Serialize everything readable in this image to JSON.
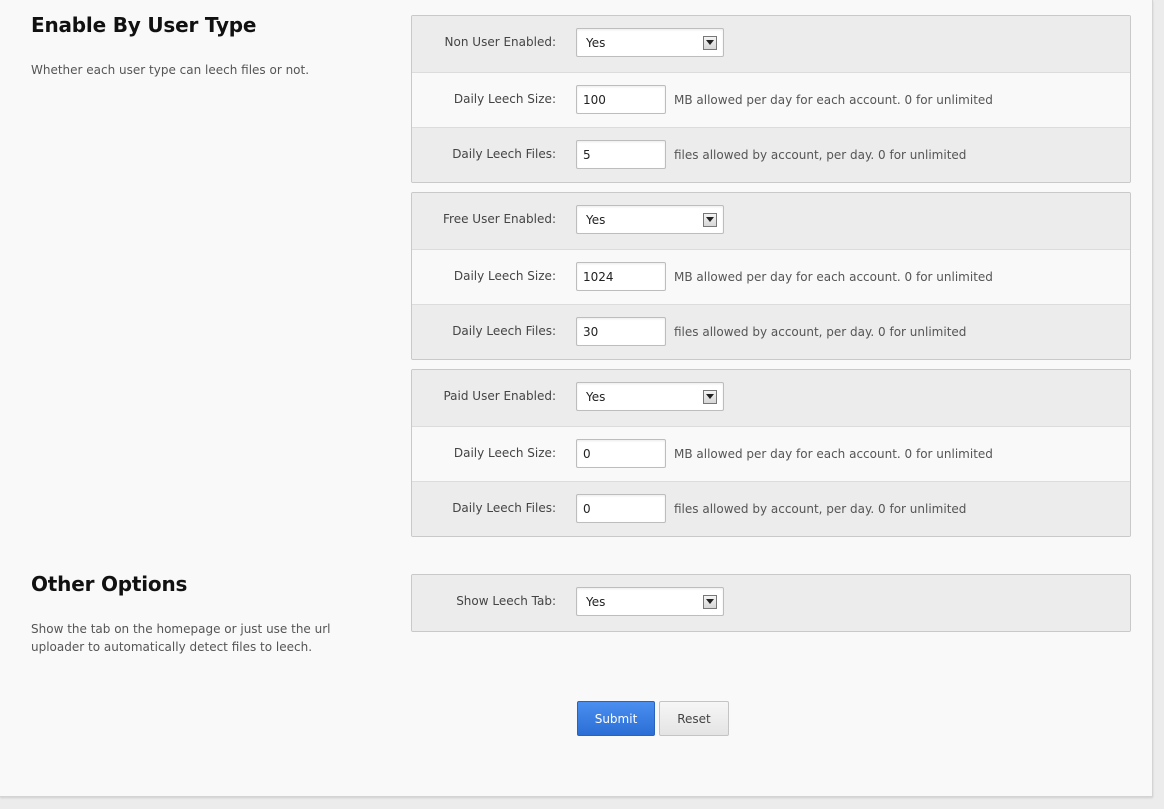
{
  "sections": {
    "user_type": {
      "title": "Enable By User Type",
      "description": "Whether each user type can leech files or not."
    },
    "other": {
      "title": "Other Options",
      "description": "Show the tab on the homepage or just use the url uploader to automatically detect files to leech."
    }
  },
  "groups": [
    {
      "enabled_label": "Non User Enabled:",
      "enabled_value": "Yes",
      "size_label": "Daily Leech Size:",
      "size_value": "100",
      "size_hint": "MB allowed per day for each account. 0 for unlimited",
      "files_label": "Daily Leech Files:",
      "files_value": "5",
      "files_hint": "files allowed by account, per day. 0 for unlimited"
    },
    {
      "enabled_label": "Free User Enabled:",
      "enabled_value": "Yes",
      "size_label": "Daily Leech Size:",
      "size_value": "1024",
      "size_hint": "MB allowed per day for each account. 0 for unlimited",
      "files_label": "Daily Leech Files:",
      "files_value": "30",
      "files_hint": "files allowed by account, per day. 0 for unlimited"
    },
    {
      "enabled_label": "Paid User Enabled:",
      "enabled_value": "Yes",
      "size_label": "Daily Leech Size:",
      "size_value": "0",
      "size_hint": "MB allowed per day for each account. 0 for unlimited",
      "files_label": "Daily Leech Files:",
      "files_value": "0",
      "files_hint": "files allowed by account, per day. 0 for unlimited"
    }
  ],
  "leech_tab": {
    "label": "Show Leech Tab:",
    "value": "Yes"
  },
  "buttons": {
    "submit": "Submit",
    "reset": "Reset"
  },
  "icons": {
    "select_arrow": "chevron-down-icon"
  },
  "colors": {
    "submit_bg": "#2b6fd6",
    "page_bg": "#f9f9f9",
    "row_shade": "#ececec"
  }
}
